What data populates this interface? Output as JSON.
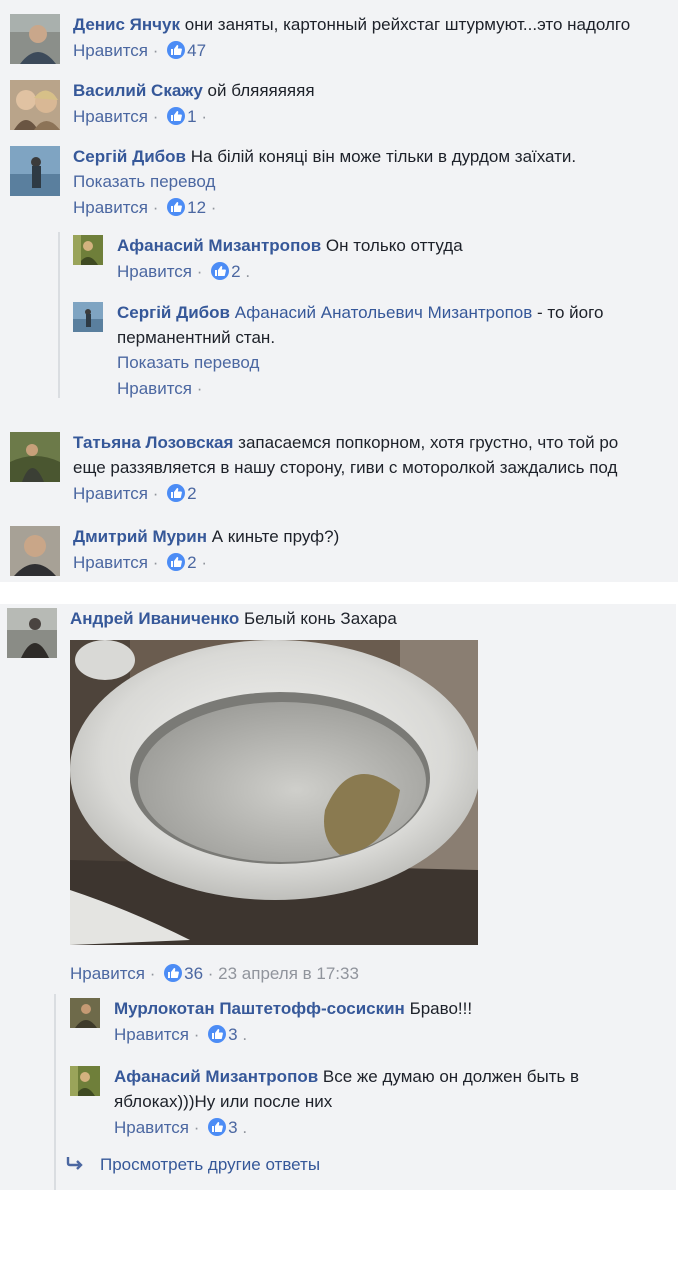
{
  "like_label": "Нравится",
  "translate_label": "Показать перевод",
  "comments": [
    {
      "author": "Денис Янчук",
      "text": "они заняты, картонный рейхстаг штурмуют...это надолго",
      "likes": "47"
    },
    {
      "author": "Василий Скажу",
      "text": "ой бляяяяяяя",
      "likes": "1"
    },
    {
      "author": "Сергій Дибов",
      "text": "На білій коняці він може тільки в дурдом заїхати.",
      "likes": "12"
    },
    {
      "author": "Татьяна Лозовская",
      "text_line1": "запасаемся попкорном, хотя грустно, что той ро",
      "text_line2": "еще раззявляется в нашу сторону, гиви с моторолкой заждались под",
      "likes": "2"
    },
    {
      "author": "Дмитрий Мурин",
      "text": "А киньте пруф?)",
      "likes": "2"
    }
  ],
  "replies_top": [
    {
      "author": "Афанасий Мизантропов",
      "text": "Он только оттуда",
      "likes": "2"
    },
    {
      "author": "Сергій Дибов",
      "mention": "Афанасий Анатольевич Мизантропов",
      "text_line1": "- то його",
      "text_line2": "перманентний стан."
    }
  ],
  "main_post": {
    "author": "Андрей Иваниченко",
    "text": "Белый конь Захара",
    "likes": "36",
    "time": "23 апреля в 17:33"
  },
  "replies_bottom": [
    {
      "author": "Мурлокотан Паштетофф-сосискин",
      "text": "Браво!!!",
      "likes": "3"
    },
    {
      "author": "Афанасий Мизантропов",
      "text_line1": "Все же думаю он должен быть в",
      "text_line2": "яблоках)))Ну или после них",
      "likes": "3"
    }
  ],
  "more_replies_label": "Просмотреть другие ответы",
  "colors": {
    "link": "#365899",
    "action": "#4b67a1",
    "panel_bg": "#f2f3f5",
    "like_blue": "#4c8cf5"
  }
}
